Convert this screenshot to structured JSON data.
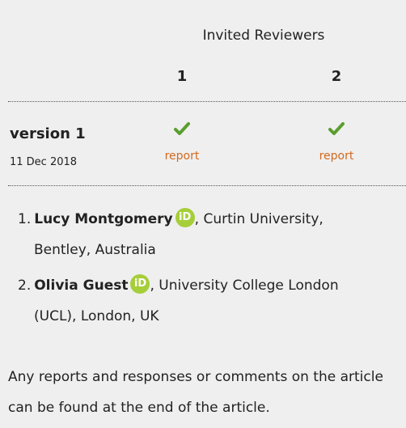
{
  "reviewers_table": {
    "title": "Invited Reviewers",
    "columns": [
      "1",
      "2"
    ],
    "rows": [
      {
        "version": "version 1",
        "date": "11 Dec 2018",
        "cells": [
          {
            "status_icon": "check-icon",
            "link": "report"
          },
          {
            "status_icon": "check-icon",
            "link": "report"
          }
        ]
      }
    ]
  },
  "reviewers": [
    {
      "num": "1.",
      "name": "Lucy Montgomery",
      "orcid_icon": "orcid-icon",
      "orcid_label": "iD",
      "affiliation_line1": ", Curtin University,",
      "affiliation_line2": "Bentley, Australia"
    },
    {
      "num": "2.",
      "name": "Olivia Guest",
      "orcid_icon": "orcid-icon",
      "orcid_label": "iD",
      "affiliation_line1": ", University College London",
      "affiliation_line2": "(UCL),  London, UK"
    }
  ],
  "footer": {
    "text": "Any reports and responses or comments on the article can be found at the end of the article."
  },
  "colors": {
    "background": "#efefef",
    "check": "#5a9e2f",
    "link": "#d2691e",
    "orcid": "#a6ce39"
  }
}
